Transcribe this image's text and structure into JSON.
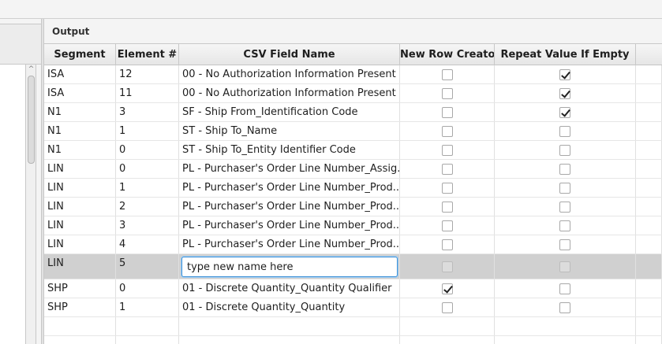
{
  "output": {
    "title": "Output",
    "columns": [
      "Segment",
      "Element #",
      "CSV Field Name",
      "New Row Creator",
      "Repeat Value If Empty"
    ],
    "rows": [
      {
        "segment": "ISA",
        "element": "12",
        "field": "00 - No Authorization Information Present ...",
        "new_row": false,
        "repeat": true
      },
      {
        "segment": "ISA",
        "element": "11",
        "field": "00 - No Authorization Information Present ...",
        "new_row": false,
        "repeat": true
      },
      {
        "segment": "N1",
        "element": "3",
        "field": "SF - Ship From_Identification Code",
        "new_row": false,
        "repeat": true
      },
      {
        "segment": "N1",
        "element": "1",
        "field": "ST - Ship To_Name",
        "new_row": false,
        "repeat": false
      },
      {
        "segment": "N1",
        "element": "0",
        "field": "ST - Ship To_Entity Identifier Code",
        "new_row": false,
        "repeat": false
      },
      {
        "segment": "LIN",
        "element": "0",
        "field": "PL - Purchaser's Order Line Number_Assig...",
        "new_row": false,
        "repeat": false
      },
      {
        "segment": "LIN",
        "element": "1",
        "field": "PL - Purchaser's Order Line Number_Prod...",
        "new_row": false,
        "repeat": false
      },
      {
        "segment": "LIN",
        "element": "2",
        "field": "PL - Purchaser's Order Line Number_Prod...",
        "new_row": false,
        "repeat": false
      },
      {
        "segment": "LIN",
        "element": "3",
        "field": "PL - Purchaser's Order Line Number_Prod...",
        "new_row": false,
        "repeat": false
      },
      {
        "segment": "LIN",
        "element": "4",
        "field": "PL - Purchaser's Order Line Number_Prod...",
        "new_row": false,
        "repeat": false
      }
    ],
    "editing_row": {
      "segment": "LIN",
      "element": "5",
      "field_value": "type new name here",
      "new_row": false,
      "repeat": false
    },
    "rows_after": [
      {
        "segment": "SHP",
        "element": "0",
        "field": "01 - Discrete Quantity_Quantity Qualifier",
        "new_row": true,
        "repeat": false
      },
      {
        "segment": "SHP",
        "element": "1",
        "field": "01 - Discrete Quantity_Quantity",
        "new_row": false,
        "repeat": false
      }
    ]
  },
  "left_scroll": {
    "up_arrow": "^"
  }
}
